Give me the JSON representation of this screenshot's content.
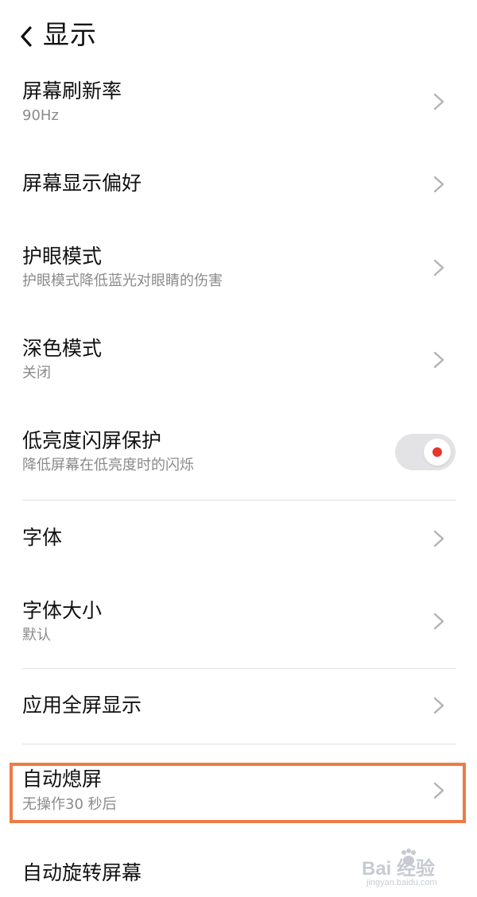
{
  "header": {
    "title": "显示",
    "back_icon": "chevron-left-icon"
  },
  "settings": [
    {
      "id": "refresh-rate",
      "title": "屏幕刷新率",
      "subtitle": "90Hz",
      "control": "chevron"
    },
    {
      "id": "display-preference",
      "title": "屏幕显示偏好",
      "subtitle": "",
      "control": "chevron"
    },
    {
      "id": "eye-protection",
      "title": "护眼模式",
      "subtitle": "护眼模式降低蓝光对眼睛的伤害",
      "control": "chevron"
    },
    {
      "id": "dark-mode",
      "title": "深色模式",
      "subtitle": "关闭",
      "control": "chevron"
    },
    {
      "id": "low-brightness-flicker",
      "title": "低亮度闪屏保护",
      "subtitle": "降低屏幕在低亮度时的闪烁",
      "control": "toggle",
      "toggle_on": true
    },
    {
      "id": "font",
      "title": "字体",
      "subtitle": "",
      "control": "chevron"
    },
    {
      "id": "font-size",
      "title": "字体大小",
      "subtitle": "默认",
      "control": "chevron"
    },
    {
      "id": "full-screen-apps",
      "title": "应用全屏显示",
      "subtitle": "",
      "control": "chevron"
    },
    {
      "id": "auto-screen-off",
      "title": "自动熄屏",
      "subtitle": "无操作30 秒后",
      "control": "chevron",
      "highlighted": true
    },
    {
      "id": "auto-rotate",
      "title": "自动旋转屏幕",
      "subtitle": "",
      "control": "none"
    }
  ],
  "watermark": {
    "main": "Bai  经验",
    "sub": "jingyan.baidu.com"
  },
  "colors": {
    "highlight": "#ef7a45",
    "toggle_dot": "#e8362b",
    "subtitle": "#8a8a8a",
    "divider": "#e2e2e2"
  }
}
